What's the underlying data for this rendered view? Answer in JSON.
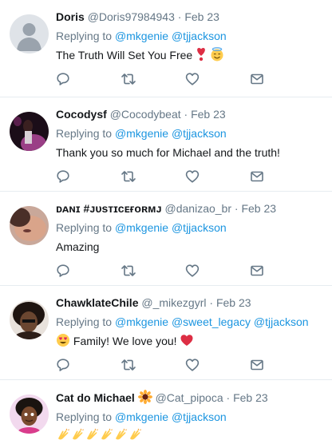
{
  "tweets": [
    {
      "name": "Doris",
      "handle": "@Doris97984943",
      "separator": "·",
      "date": "Feb 23",
      "replying_prefix": "Replying to",
      "mentions": [
        "@mkgenie",
        "@tjjackson"
      ],
      "text": "The Truth Will Set You Free",
      "emojis": [
        "heavy-heart-exclamation",
        "smiling-face-with-halo"
      ]
    },
    {
      "name": "Cocodysf",
      "handle": "@Cocodybeat",
      "separator": "·",
      "date": "Feb 23",
      "replying_prefix": "Replying to",
      "mentions": [
        "@mkgenie",
        "@tjjackson"
      ],
      "text": "Thank you so much for Michael and the truth!"
    },
    {
      "name": "ᴅᴀɴɪ #ᴊᴜsᴛɪᴄᴇғᴏʀᴍᴊ",
      "handle": "@danizao_br",
      "separator": "·",
      "date": "Feb 23",
      "replying_prefix": "Replying to",
      "mentions": [
        "@mkgenie",
        "@tjjackson"
      ],
      "text": "Amazing"
    },
    {
      "name": "ChawklateChile",
      "handle": "@_mikezgyrl",
      "separator": "·",
      "date": "Feb 23",
      "replying_prefix": "Replying to",
      "mentions": [
        "@mkgenie",
        "@sweet_legacy",
        "@tjjackson"
      ],
      "text": "Family! We love you!",
      "emojis": [
        "heart-eyes-face",
        "red-heart"
      ]
    },
    {
      "name": "Cat do Michael",
      "handle": "@Cat_pipoca",
      "separator": "·",
      "date": "Feb 23",
      "replying_prefix": "Replying to",
      "mentions": [
        "@mkgenie",
        "@tjjackson"
      ],
      "text": "",
      "name_emoji": "sunflower",
      "emojis": [
        "clapping-hands",
        "clapping-hands",
        "clapping-hands",
        "clapping-hands",
        "clapping-hands",
        "clapping-hands"
      ]
    }
  ],
  "actions": [
    "reply-icon",
    "retweet-icon",
    "like-icon",
    "direct-message-icon"
  ],
  "colors": {
    "mention": "#1b95e0",
    "secondary_text": "#657786",
    "icon": "#657786",
    "divider": "#e6ecf0"
  }
}
